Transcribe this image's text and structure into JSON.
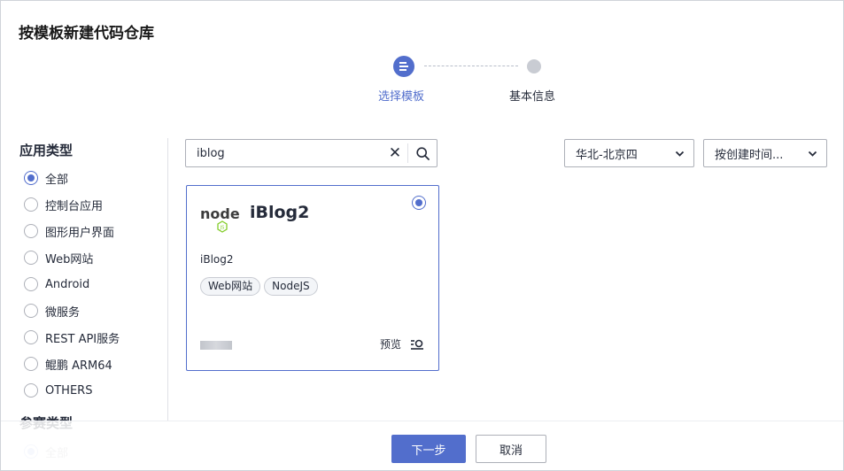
{
  "dialog": {
    "title": "按模板新建代码仓库"
  },
  "stepper": {
    "steps": [
      {
        "label": "选择模板",
        "state": "active"
      },
      {
        "label": "基本信息",
        "state": "pending"
      }
    ]
  },
  "filters": {
    "app_type_title": "应用类型",
    "app_types": [
      {
        "label": "全部",
        "checked": true
      },
      {
        "label": "控制台应用",
        "checked": false
      },
      {
        "label": "图形用户界面",
        "checked": false
      },
      {
        "label": "Web网站",
        "checked": false
      },
      {
        "label": "Android",
        "checked": false
      },
      {
        "label": "微服务",
        "checked": false
      },
      {
        "label": "REST API服务",
        "checked": false
      },
      {
        "label": "鲲鹏 ARM64",
        "checked": false
      },
      {
        "label": "OTHERS",
        "checked": false
      }
    ],
    "contest_type_title": "参赛类型",
    "contest_types": [
      {
        "label": "全部",
        "checked": true
      }
    ]
  },
  "search": {
    "value": "iblog"
  },
  "region_select": {
    "value": "华北-北京四"
  },
  "sort_select": {
    "value": "按创建时间..."
  },
  "templates": [
    {
      "name": "iBlog2",
      "description": "iBlog2",
      "tags": [
        "Web网站",
        "NodeJS"
      ],
      "selected": true,
      "preview_label": "预览",
      "logo_text": "node"
    }
  ],
  "footer": {
    "next_label": "下一步",
    "cancel_label": "取消"
  },
  "colors": {
    "primary": "#526ecc",
    "node_green": "#83cd29",
    "text": "#252b3a"
  }
}
